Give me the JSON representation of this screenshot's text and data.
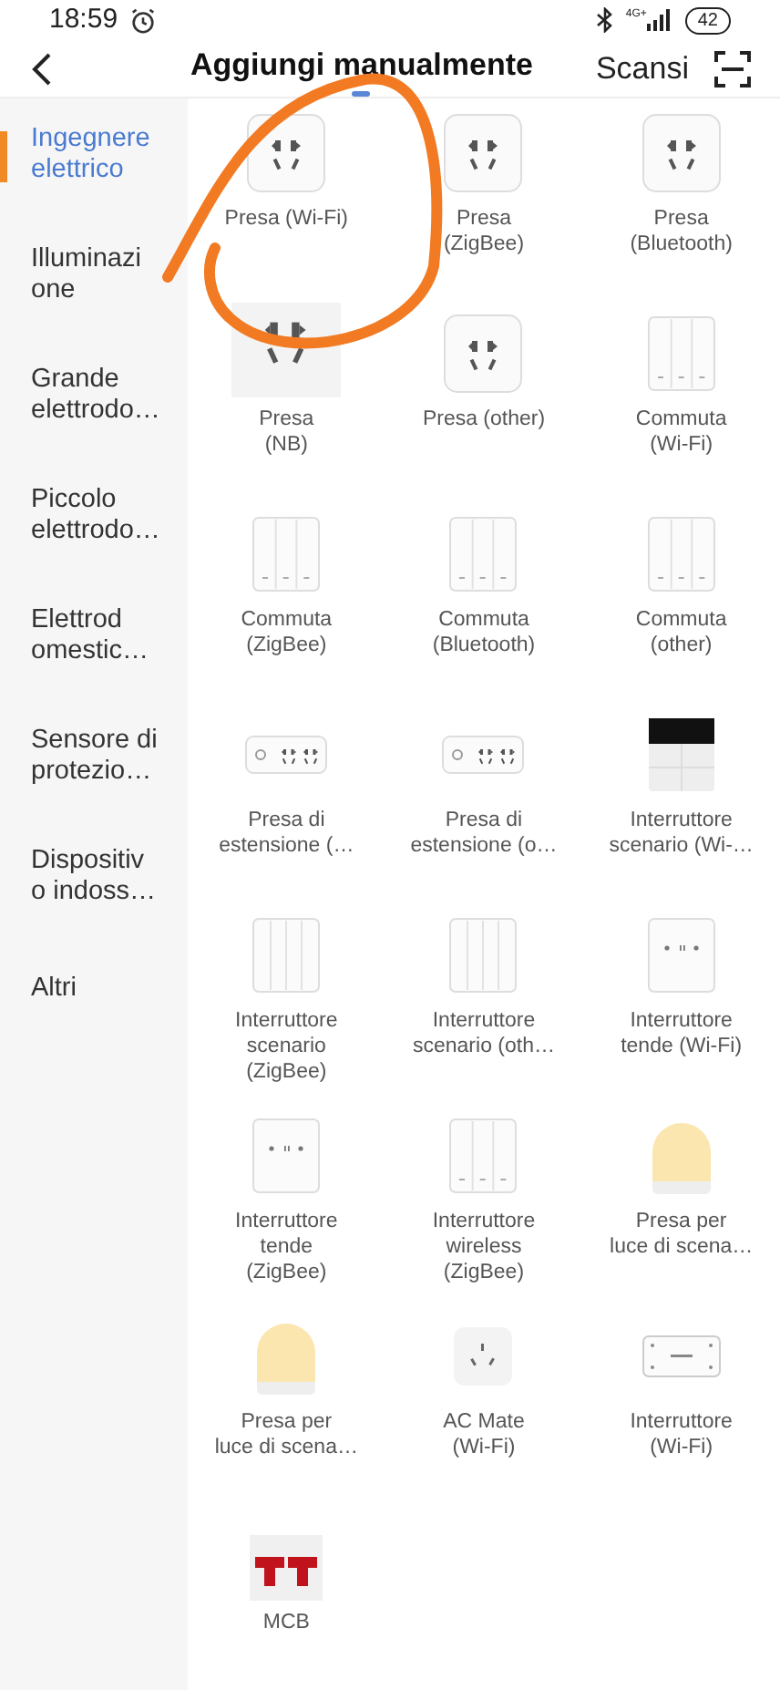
{
  "status_bar": {
    "time": "18:59",
    "network": "4G+",
    "battery": "42"
  },
  "header": {
    "title": "Aggiungi manualmente",
    "scan": "Scansi"
  },
  "sidebar": {
    "items": [
      {
        "label": "Ingegnere\nelettrico",
        "selected": true
      },
      {
        "label": "Illuminazi\none",
        "selected": false
      },
      {
        "label": "Grande\nelettrodo…",
        "selected": false
      },
      {
        "label": "Piccolo\nelettrodo…",
        "selected": false
      },
      {
        "label": "Elettrod\nomestic…",
        "selected": false
      },
      {
        "label": "Sensore di\nprotezio…",
        "selected": false
      },
      {
        "label": "Dispositiv\no indoss…",
        "selected": false
      },
      {
        "label": "Altri",
        "selected": false
      }
    ]
  },
  "devices": [
    {
      "kind": "socket",
      "label": "Presa (Wi-Fi)"
    },
    {
      "kind": "socket",
      "label": "Presa\n(ZigBee)"
    },
    {
      "kind": "socket",
      "label": "Presa\n(Bluetooth)"
    },
    {
      "kind": "socket-large",
      "label": "Presa\n(NB)"
    },
    {
      "kind": "socket",
      "label": "Presa (other)"
    },
    {
      "kind": "switch3",
      "label": "Commuta\n(Wi-Fi)"
    },
    {
      "kind": "switch3",
      "label": "Commuta\n(ZigBee)"
    },
    {
      "kind": "switch3",
      "label": "Commuta\n(Bluetooth)"
    },
    {
      "kind": "switch3",
      "label": "Commuta\n(other)"
    },
    {
      "kind": "strip",
      "label": "Presa di\nestensione (…"
    },
    {
      "kind": "strip",
      "label": "Presa di\nestensione (o…"
    },
    {
      "kind": "scene-panel",
      "label": "Interruttore\nscenario (Wi-…"
    },
    {
      "kind": "switch4",
      "label": "Interruttore\nscenario\n(ZigBee)"
    },
    {
      "kind": "switch4",
      "label": "Interruttore\nscenario (oth…"
    },
    {
      "kind": "curtain",
      "label": "Interruttore\ntende (Wi-Fi)"
    },
    {
      "kind": "curtain",
      "label": "Interruttore\ntende\n(ZigBee)"
    },
    {
      "kind": "switch3",
      "label": "Interruttore\nwireless\n(ZigBee)"
    },
    {
      "kind": "lamp",
      "label": "Presa per\nluce di scena…"
    },
    {
      "kind": "lamp",
      "label": "Presa per\nluce di scena…"
    },
    {
      "kind": "acmate",
      "label": "AC Mate\n(Wi-Fi)"
    },
    {
      "kind": "breaker",
      "label": "Interruttore\n(Wi-Fi)"
    },
    {
      "kind": "mcb",
      "label": "MCB"
    }
  ]
}
